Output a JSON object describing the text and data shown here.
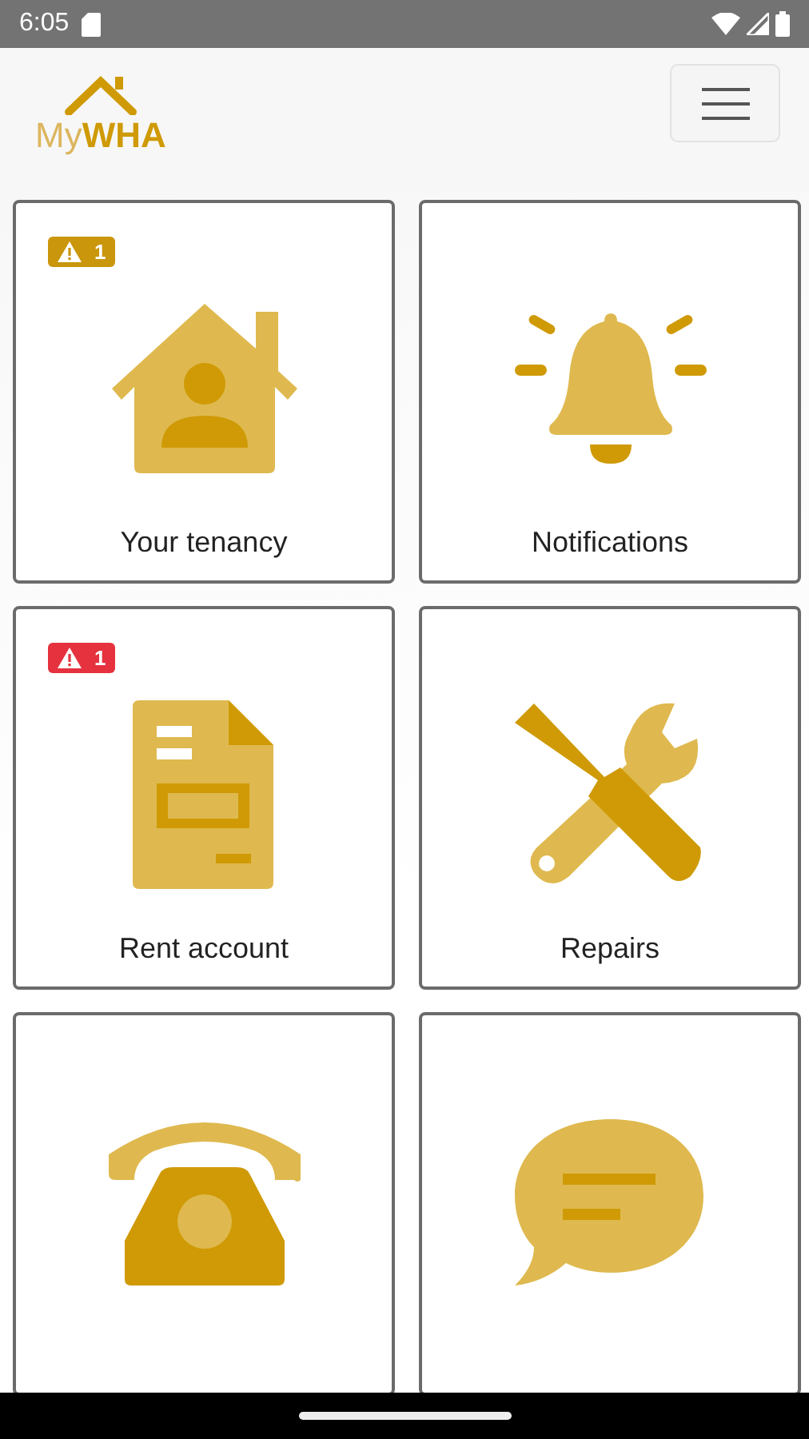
{
  "status_bar": {
    "time": "6:05"
  },
  "header": {
    "logo": {
      "light": "My",
      "bold": "WHA"
    }
  },
  "tiles": [
    {
      "kind": "house",
      "label": "Your tenancy",
      "badge": {
        "count": "1",
        "color": "#c9960c"
      }
    },
    {
      "kind": "bell",
      "label": "Notifications"
    },
    {
      "kind": "document",
      "label": "Rent account",
      "badge": {
        "count": "1",
        "color": "#e5323e"
      }
    },
    {
      "kind": "tools",
      "label": "Repairs"
    },
    {
      "kind": "phone"
    },
    {
      "kind": "chat"
    }
  ]
}
